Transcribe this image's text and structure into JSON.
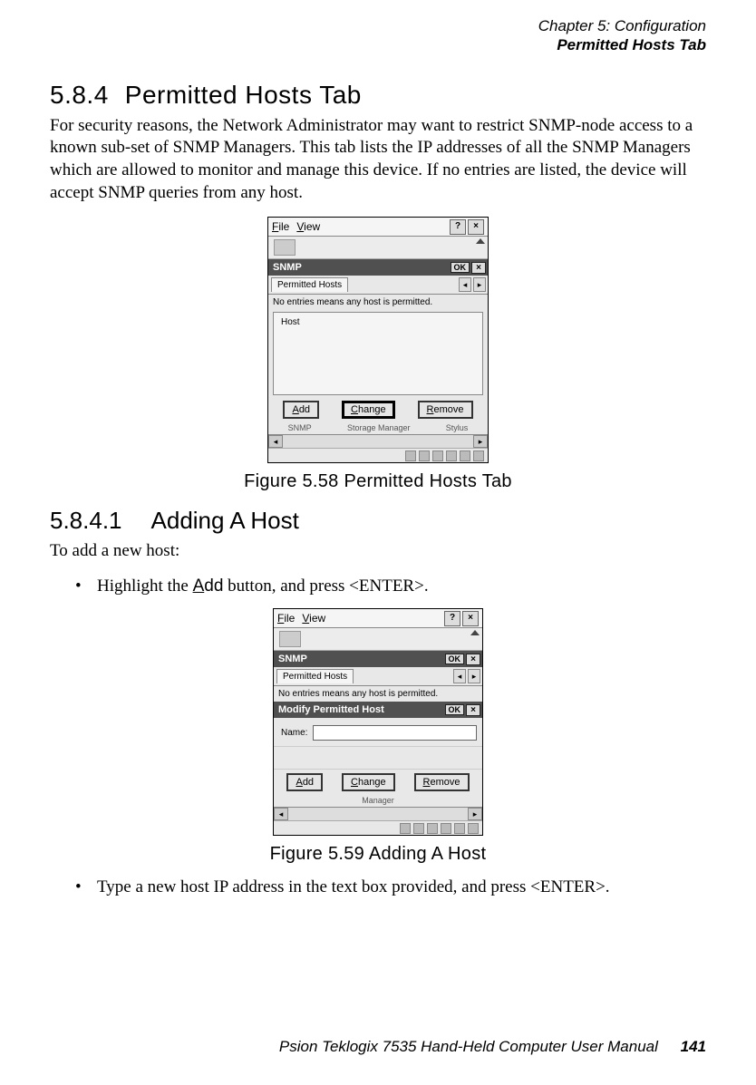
{
  "header": {
    "chapter": "Chapter 5: Configuration",
    "section": "Permitted Hosts Tab"
  },
  "s1": {
    "num": "5.8.4",
    "title": "Permitted Hosts Tab",
    "para": "For security reasons, the Network Administrator may want to restrict SNMP-node access to a known sub-set of SNMP Managers. This tab lists the IP addresses of all the SNMP Managers which are allowed to monitor and manage this device. If no entries are listed, the device will accept SNMP queries from any host."
  },
  "figA": {
    "caption": "Figure 5.58 Permitted Hosts Tab",
    "menu_file": "File",
    "menu_view": "View",
    "help": "?",
    "close": "×",
    "dlg_title": "SNMP",
    "ok": "OK",
    "tab": "Permitted Hosts",
    "nav_l": "◂",
    "nav_r": "▸",
    "hint": "No entries means any host is permitted.",
    "group": "Host",
    "btn_add": "Add",
    "btn_change": "Change",
    "btn_remove": "Remove",
    "under1": "SNMP",
    "under2": "Storage Manager",
    "under3": "Stylus",
    "arrow_l": "◂",
    "arrow_r": "▸"
  },
  "s2": {
    "num": "5.8.4.1",
    "title": "Adding A Host",
    "intro": "To add a new host:",
    "bullet1_pre": "Highlight the ",
    "bullet1_btn": "Add",
    "bullet1_post": " button, and press <ENTER>.",
    "bullet2": "Type a new host IP address in the text box provided, and press <ENTER>."
  },
  "figB": {
    "caption": "Figure 5.59 Adding A Host",
    "menu_file": "File",
    "menu_view": "View",
    "help": "?",
    "close": "×",
    "dlg1_title": "SNMP",
    "ok": "OK",
    "tab": "Permitted Hosts",
    "nav_l": "◂",
    "nav_r": "▸",
    "hint": "No entries means any host is permitted.",
    "dlg2_title": "Modify Permitted Host",
    "name_label": "Name:",
    "btn_add": "Add",
    "btn_change": "Change",
    "btn_remove": "Remove",
    "under2": "Manager",
    "arrow_l": "◂",
    "arrow_r": "▸"
  },
  "footer": {
    "text": "Psion Teklogix 7535 Hand-Held Computer User Manual",
    "page": "141"
  }
}
